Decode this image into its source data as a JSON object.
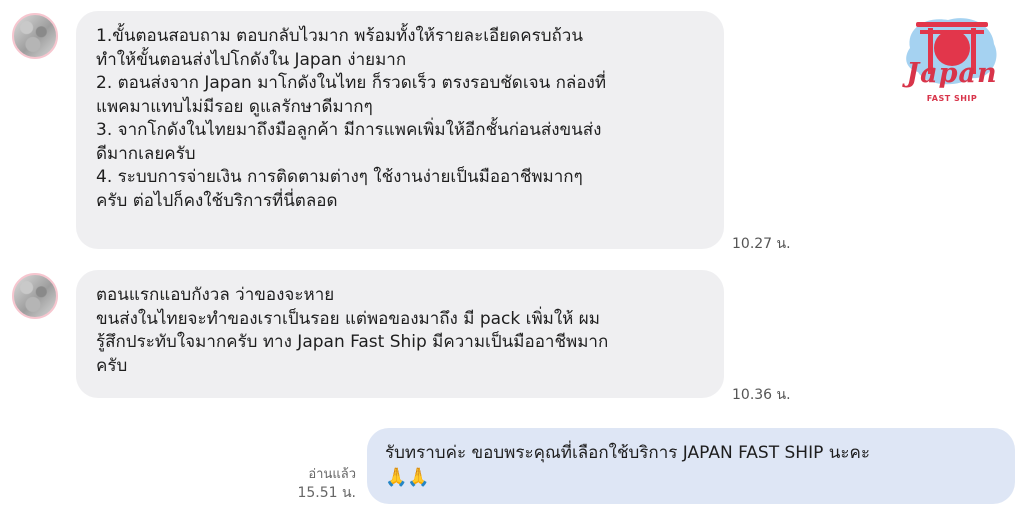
{
  "logo": {
    "title": "Japan",
    "subtitle": "FAST SHIP"
  },
  "messages": [
    {
      "lines": [
        "1.ขั้นตอนสอบถาม ตอบกลับไวมาก พร้อมทั้งให้รายละเอียดครบถ้วน",
        "ทำให้ขั้นตอนส่งไปโกดังใน Japan ง่ายมาก",
        "2. ตอนส่งจาก Japan มาโกดังในไทย ก็รวดเร็ว ตรงรอบชัดเจน กล่องที่",
        "แพคมาแทบไม่มีรอย ดูแลรักษาดีมากๆ",
        "3. จากโกดังในไทยมาถึงมือลูกค้า มีการแพคเพิ่มให้อีกชั้นก่อนส่งขนส่ง",
        "ดีมากเลยครับ",
        "4. ระบบการจ่ายเงิน การติดตามต่างๆ ใช้งานง่ายเป็นมืออาชีพมากๆ",
        "ครับ ต่อไปก็คงใช้บริการที่นี่ตลอด"
      ],
      "time": "10.27 น."
    },
    {
      "lines": [
        "ตอนแรกแอบกังวล ว่าของจะหาย",
        "ขนส่งในไทยจะทำของเราเป็นรอย  แต่พอของมาถึง มี pack เพิ่มให้ ผม",
        "รู้สึกประทับใจมากครับ ทาง Japan Fast Ship มีความเป็นมืออาชีพมาก",
        "ครับ"
      ],
      "time": "10.36 น."
    },
    {
      "lines": [
        "รับทราบค่ะ ขอบพระคุณที่เลือกใช้บริการ JAPAN FAST SHIP นะคะ",
        "🙏🙏"
      ],
      "read_status": "อ่านแล้ว",
      "time": "15.51 น."
    }
  ],
  "colors": {
    "incoming_bubble": "#efeff1",
    "outgoing_bubble": "#dee6f5",
    "brand_red": "#d8344a"
  }
}
